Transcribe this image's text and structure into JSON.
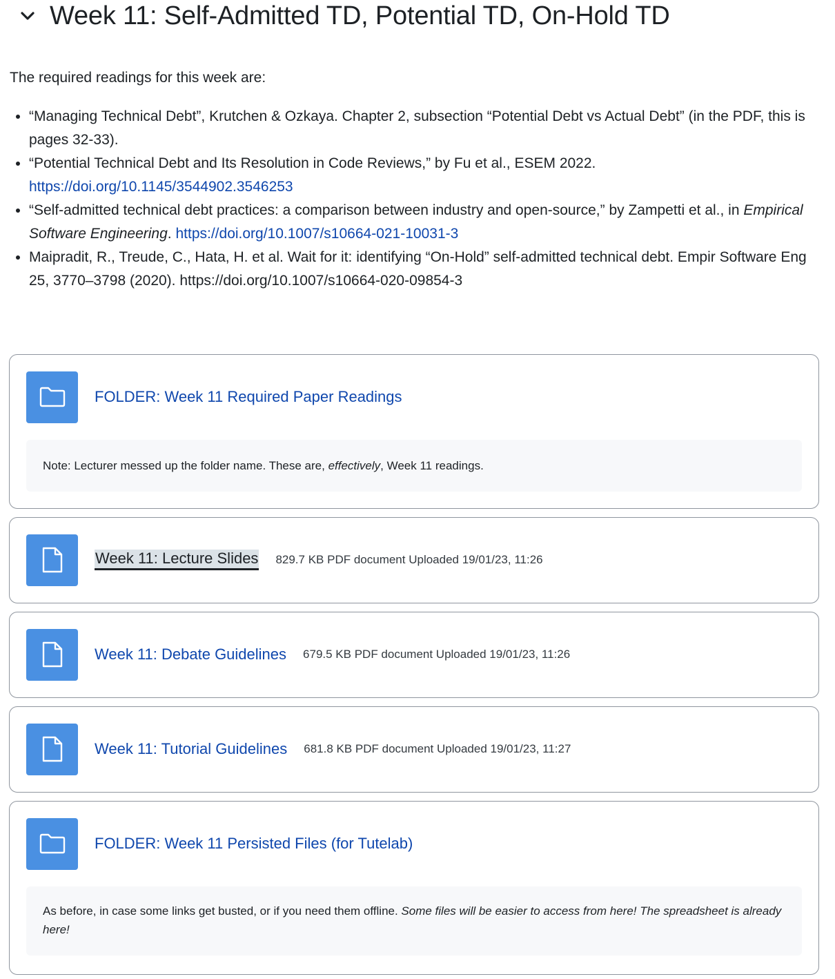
{
  "section": {
    "title": "Week 11: Self-Admitted TD, Potential TD, On-Hold TD",
    "toggle_icon": "chevron-down-icon"
  },
  "summary": {
    "intro": "The required readings for this week are:",
    "readings": [
      {
        "text": "“Managing Technical Debt”, Krutchen & Ozkaya. Chapter 2, subsection “Potential Debt vs Actual Debt” (in the PDF, this is pages 32-33)."
      },
      {
        "text": "“Potential Technical Debt and Its Resolution in Code Reviews,” by Fu et al., ESEM 2022.",
        "link": "https://doi.org/10.1145/3544902.3546253"
      },
      {
        "text": "“Self-admitted technical debt practices: a comparison between industry and open-source,” by Zampetti et al., in",
        "journal": "Empirical Software Engineering",
        "after_journal": ".",
        "link": "https://doi.org/10.1007/s10664-021-10031-3"
      },
      {
        "text": "Maipradit, R., Treude, C., Hata, H. et al. Wait for it: identifying “On-Hold” self-admitted technical debt. Empir Software Eng 25, 3770–3798 (2020). https://doi.org/10.1007/s10664-020-09854-3"
      }
    ]
  },
  "activities": [
    {
      "type": "folder",
      "icon": "folder-icon",
      "name": "FOLDER: Week 11 Required Paper Readings",
      "note_before": "Note: Lecturer messed up the folder name. These are, ",
      "note_em": "effectively",
      "note_after": ", Week 11 readings."
    },
    {
      "type": "resource",
      "icon": "file-icon",
      "name": "Week 11: Lecture Slides",
      "meta": "829.7 KB PDF document Uploaded 19/01/23, 11:26"
    },
    {
      "type": "resource",
      "icon": "file-icon",
      "name": "Week 11: Debate Guidelines",
      "meta": "679.5 KB PDF document Uploaded 19/01/23, 11:26"
    },
    {
      "type": "resource",
      "icon": "file-icon",
      "name": "Week 11: Tutorial Guidelines",
      "meta": "681.8 KB PDF document Uploaded 19/01/23, 11:27"
    },
    {
      "type": "folder",
      "icon": "folder-icon",
      "name": "FOLDER: Week 11 Persisted Files (for Tutelab)",
      "note_before": "As before, in case some links get busted, or if you need them offline. ",
      "note_em": "Some files will be easier to access from here! The spreadsheet is already here!"
    }
  ]
}
